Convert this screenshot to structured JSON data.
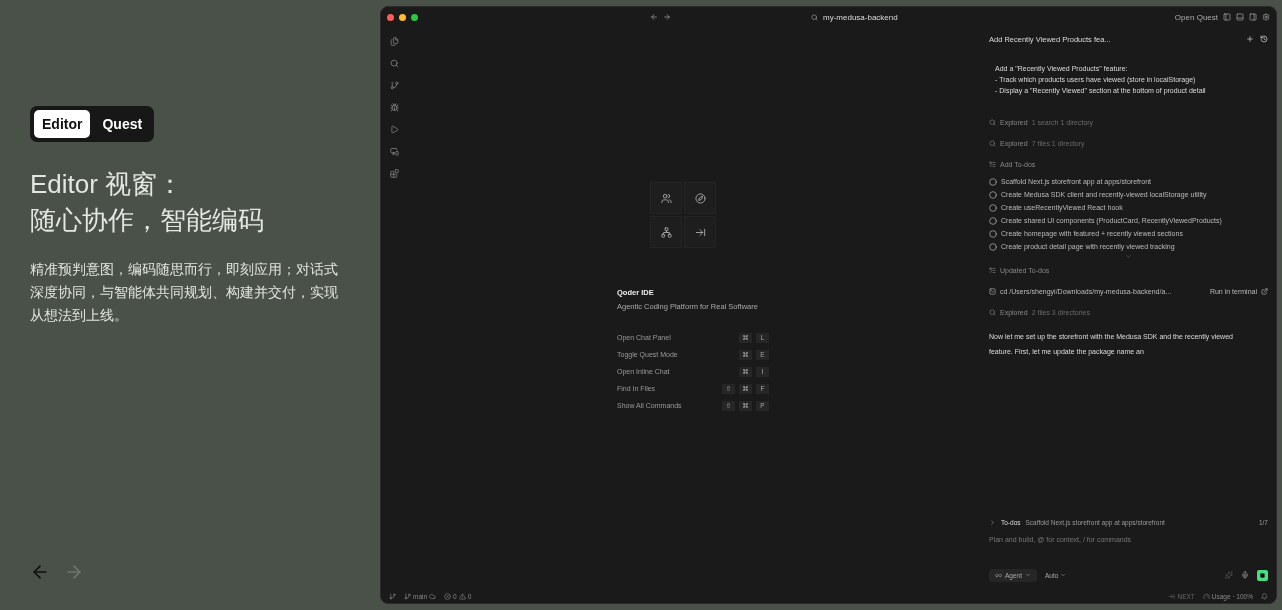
{
  "tabs": [
    {
      "label": "Editor",
      "selected": true
    },
    {
      "label": "Quest",
      "selected": false
    }
  ],
  "headline": [
    "Editor 视窗：",
    "随心协作，智能编码"
  ],
  "description": "精准预判意图，编码随思而行，即刻应用；对话式深度协同，与智能体共同规划、构建并交付，实现从想法到上线。",
  "nav": [
    {
      "kind": "back",
      "disabled": false
    },
    {
      "kind": "forward",
      "disabled": true
    }
  ],
  "ide": {
    "title": "my-medusa-backend",
    "open_quest": "Open Quest",
    "welcome": {
      "title": "Qoder IDE",
      "subtitle": "Agentic Coding Platform for Real Software",
      "shortcuts": [
        {
          "label": "Open Chat Panel",
          "keys": [
            "⌘",
            "L"
          ]
        },
        {
          "label": "Toggle Quest Mode",
          "keys": [
            "⌘",
            "E"
          ]
        },
        {
          "label": "Open Inline Chat",
          "keys": [
            "⌘",
            "I"
          ]
        },
        {
          "label": "Find In Files",
          "keys": [
            "⇧",
            "⌘",
            "F"
          ]
        },
        {
          "label": "Show All Commands",
          "keys": [
            "⇧",
            "⌘",
            "P"
          ]
        }
      ]
    },
    "chat": {
      "title": "Add Recently Viewed Products fea...",
      "prompt": [
        "Add a \"Recently Viewed Products\" feature:",
        "- Track which products users have viewed (store in localStorage)",
        "- Display a \"Recently Viewed\" section at the bottom of product detail"
      ],
      "steps": [
        {
          "kind": "explored",
          "label": "Explored",
          "detail": "1 search 1 directory"
        },
        {
          "kind": "explored",
          "label": "Explored",
          "detail": "7 files 1 directory"
        },
        {
          "kind": "todos",
          "label": "Add To-dos",
          "items": [
            {
              "text": "Scaffold Next.js storefront app at apps/storefront",
              "checked": false
            },
            {
              "text": "Create Medusa SDK client and recently-viewed localStorage utility",
              "checked": false
            },
            {
              "text": "Create useRecentlyViewed React hook",
              "checked": false
            },
            {
              "text": "Create shared UI components (ProductCard, RecentlyViewedProducts)",
              "checked": false
            },
            {
              "text": "Create homepage with featured + recently viewed sections",
              "checked": false
            },
            {
              "text": "Create product detail page with recently viewed tracking",
              "checked": false
            }
          ]
        },
        {
          "kind": "updated",
          "label": "Updated To-dos"
        },
        {
          "kind": "command",
          "text": "cd /Users/shengyi/Downloads/my-medusa-backend/a...",
          "action": "Run in terminal"
        },
        {
          "kind": "explored",
          "label": "Explored",
          "detail": "2 files 3 directories"
        },
        {
          "kind": "message",
          "text": "Now let me set up the storefront with the Medusa SDK and the recently viewed feature. First, let me update the package name an"
        }
      ],
      "todo_bar": {
        "label": "To-dos",
        "text": "Scaffold Next.js storefront app at apps/storefront",
        "count": "1/7"
      },
      "input": {
        "placeholder": "Plan and build, @ for context, / for commands"
      },
      "mode": "Agent",
      "model": "Auto"
    },
    "status": {
      "branch": "main",
      "errors": "0",
      "warnings": "0",
      "next": "NEXT",
      "usage": "Usage · 100%"
    }
  }
}
